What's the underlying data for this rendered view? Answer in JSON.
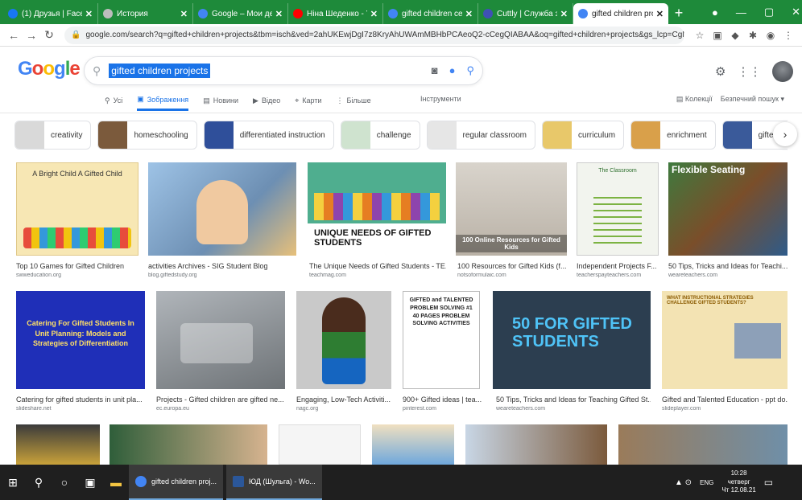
{
  "browser": {
    "tabs": [
      {
        "label": "(1) Друзья | Faceb",
        "icon_color": "#1877f2"
      },
      {
        "label": "История",
        "icon_color": "#bdbdbd"
      },
      {
        "label": "Google – Мои дейс",
        "icon_color": "#4285f4"
      },
      {
        "label": "Ніна Шеденко - Y",
        "icon_color": "#ff0000"
      },
      {
        "label": "gifted children cer",
        "icon_color": "#4285f4"
      },
      {
        "label": "Cuttly | Служба за",
        "icon_color": "#3f51b5"
      },
      {
        "label": "gifted children proj",
        "icon_color": "#4285f4"
      }
    ],
    "url": "google.com/search?q=gifted+children+projects&tbm=isch&ved=2ahUKEwjDgI7z8KryAhUWAmMBHbPCAeoQ2-cCegQIABAA&oq=gifted+children+projects&gs_lcp=CgNpb..."
  },
  "google": {
    "logo": "Google",
    "query": "gifted children projects",
    "tabs": [
      {
        "label": "Усі",
        "icon": "search-icon"
      },
      {
        "label": "Зображення",
        "icon": "image-icon"
      },
      {
        "label": "Новини",
        "icon": "news-icon"
      },
      {
        "label": "Відео",
        "icon": "video-icon"
      },
      {
        "label": "Карти",
        "icon": "map-pin-icon"
      },
      {
        "label": "Більше",
        "icon": "more-icon"
      }
    ],
    "tools": "Інструменти",
    "collections": "Колекції",
    "safe_search": "Безпечний пошук"
  },
  "chips": [
    {
      "label": "creativity",
      "color": "#d9d9d9"
    },
    {
      "label": "homeschooling",
      "color": "#7b5a3c"
    },
    {
      "label": "differentiated instruction",
      "color": "#2f4f9a"
    },
    {
      "label": "challenge",
      "color": "#cfe3cf"
    },
    {
      "label": "regular classroom",
      "color": "#e6e6e6"
    },
    {
      "label": "curriculum",
      "color": "#e8c86a"
    },
    {
      "label": "enrichment",
      "color": "#d9a04a"
    },
    {
      "label": "gifted edu",
      "color": "#3a5a9a"
    }
  ],
  "results": [
    {
      "caption": "Top 10 Games for Gifted Children",
      "source": "swweducation.org",
      "bg": "#f7e7b4",
      "text": "A Bright Child   A Gifted Child"
    },
    {
      "caption": "activities Archives - SIG Student Blog",
      "source": "blog.giftedstudy.org",
      "bg": "#6d8fb3",
      "text": ""
    },
    {
      "caption": "The Unique Needs of Gifted Students - TE...",
      "source": "teachmag.com",
      "bg": "#4fae8f",
      "text": "UNIQUE NEEDS OF GIFTED STUDENTS"
    },
    {
      "caption": "100 Resources for Gifted Kids (f...",
      "source": "notsoformulaic.com",
      "bg": "#b9b1a6",
      "text": "100 Online Resources for Gifted Kids"
    },
    {
      "caption": "Independent Projects F...",
      "source": "teacherspayteachers.com",
      "bg": "#f2f4ee",
      "text": "The Classroom"
    },
    {
      "caption": "50 Tips, Tricks and Ideas for Teachi...",
      "source": "weareteachers.com",
      "bg": "#3e7a3e",
      "text": "Flexible Seating"
    },
    {
      "caption": "Catering for gifted students in unit pla...",
      "source": "slideshare.net",
      "bg": "#1f2fb8",
      "text": "Catering For Gifted Students In Unit Planning: Models and Strategies of Differentiation"
    },
    {
      "caption": "Projects - Gifted children are gifted ne...",
      "source": "ec.europa.eu",
      "bg": "#8a8f94",
      "text": ""
    },
    {
      "caption": "Engaging, Low-Tech Activiti...",
      "source": "nagc.org",
      "bg": "#c9c9c9",
      "text": ""
    },
    {
      "caption": "900+ Gifted ideas | tea...",
      "source": "pinterest.com",
      "bg": "#ffffff",
      "text": "GIFTED and TALENTED PROBLEM SOLVING #1 40 PAGES PROBLEM SOLVING ACTIVITIES"
    },
    {
      "caption": "50 Tips, Tricks and Ideas for Teaching Gifted St...",
      "source": "weareteachers.com",
      "bg": "#2c3e50",
      "text": "50 FOR GIFTED STUDENTS"
    },
    {
      "caption": "Gifted and Talented Education - ppt do...",
      "source": "slideplayer.com",
      "bg": "#f3e3b3",
      "text": "WHAT INSTRUCTIONAL STRATEGIES CHALLENGE GIFTED STUDENTS?"
    }
  ],
  "taskbar": {
    "apps": [
      {
        "label": "gifted children proj...",
        "color": "#4285f4"
      },
      {
        "label": "ЮД (Шульга) - Wo...",
        "color": "#2b579a"
      }
    ],
    "lang": "ENG",
    "time": "10:28",
    "day": "четверг",
    "date": "Чт 12.08.21"
  }
}
